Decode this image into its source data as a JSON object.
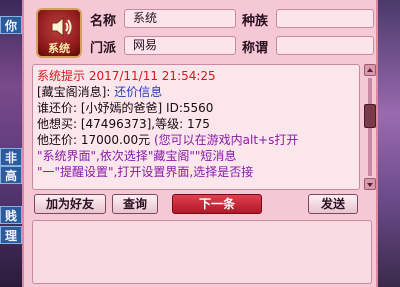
{
  "background": {
    "left_tags": [
      "你",
      "非",
      "高",
      "贱",
      "理"
    ]
  },
  "header": {
    "icon_caption": "系统",
    "name_label": "名称",
    "name_value": "系统",
    "race_label": "种族",
    "race_value": "",
    "sect_label": "门派",
    "sect_value": "网易",
    "title_label": "称谓",
    "title_value": ""
  },
  "message": {
    "header": "系统提示 2017/11/11 21:54:25",
    "l1_a": "[藏宝阁消息]:",
    "l1_b": "还价信息",
    "l2": "谁还价: [小妤嫣的爸爸] ID:5560",
    "l3": "他想买: [47496373],等级: 175",
    "l4_a": "他还价: 17000.00元",
    "l4_b": "(您可以在游戏内alt+s打开",
    "l5": "\"系统界面\",依次选择\"藏宝阁\"\"短消息",
    "l6": "\"一\"提醒设置\",打开设置界面,选择是否接"
  },
  "buttons": {
    "add_friend": "加为好友",
    "query": "查询",
    "next": "下一条",
    "send": "发送"
  },
  "colors": {
    "window_bg": "#f4c8d4",
    "text_red": "#d81818",
    "text_blue": "#2a3ab8",
    "text_purple": "#8a1aa8"
  }
}
